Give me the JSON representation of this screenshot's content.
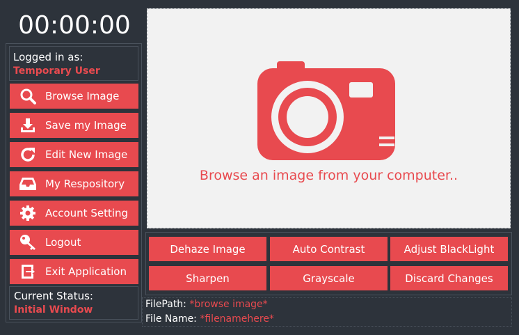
{
  "clock": "00:00:00",
  "login": {
    "label": "Logged in as:",
    "user": "Temporary User"
  },
  "sidebar": {
    "items": [
      {
        "label": "Browse Image",
        "icon": "search-icon"
      },
      {
        "label": "Save my Image",
        "icon": "download-icon"
      },
      {
        "label": "Edit New Image",
        "icon": "refresh-icon"
      },
      {
        "label": "My Respository",
        "icon": "inbox-icon"
      },
      {
        "label": "Account Setting",
        "icon": "gear-icon"
      },
      {
        "label": "Logout",
        "icon": "key-icon"
      },
      {
        "label": "Exit Application",
        "icon": "exit-icon"
      }
    ]
  },
  "status": {
    "label": "Current Status:",
    "value": "Initial Window"
  },
  "canvas": {
    "message": "Browse an image from your computer..",
    "icon": "camera-icon"
  },
  "tools": {
    "buttons": [
      "Dehaze Image",
      "Auto Contrast",
      "Adjust BlackLight",
      "Sharpen",
      "Grayscale",
      "Discard Changes"
    ]
  },
  "file": {
    "path_label": "FilePath:",
    "path_value": "*browse image*",
    "name_label": "File Name:",
    "name_value": "*filenamehere*"
  },
  "colors": {
    "accent": "#e84a4f",
    "background": "#2d333b",
    "canvas": "#f2f2f2"
  }
}
